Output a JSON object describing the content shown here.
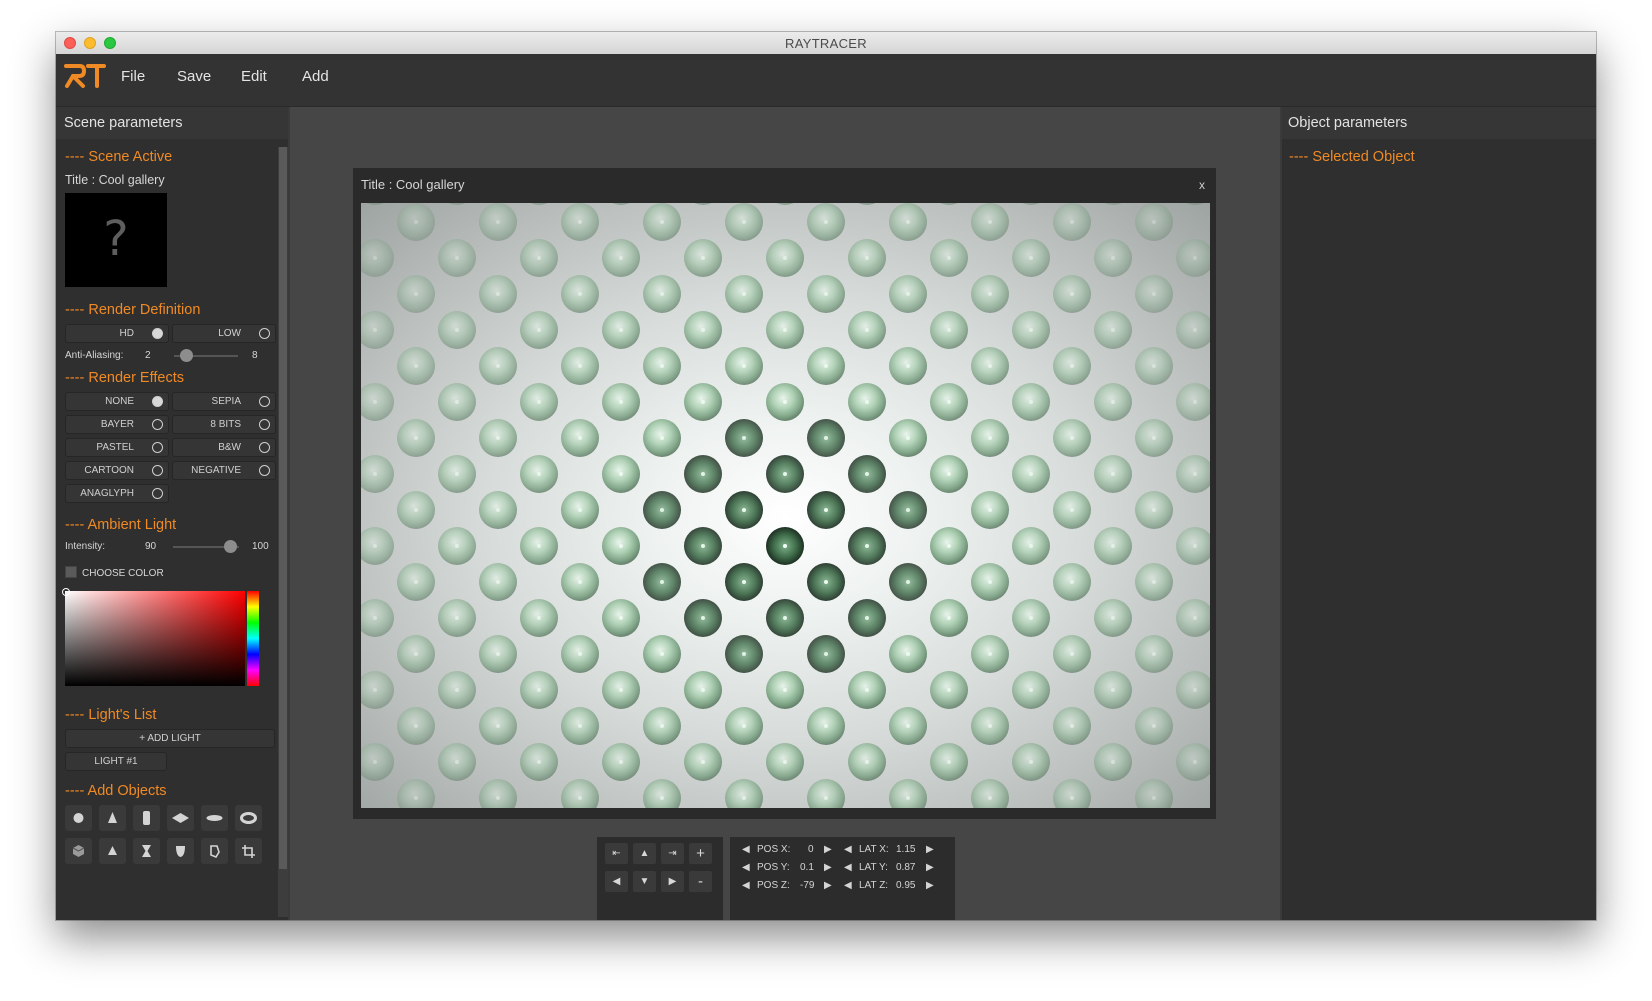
{
  "window": {
    "title": "RAYTRACER"
  },
  "menu": {
    "logo": "RT",
    "items": [
      "File",
      "Save",
      "Edit",
      "Add"
    ]
  },
  "left_panel": {
    "header": "Scene parameters",
    "scene_active": {
      "section": "---- Scene Active",
      "title": "Title : Cool gallery",
      "thumbnail_glyph": "?"
    },
    "render_definition": {
      "section": "---- Render Definition",
      "hd": "HD",
      "low": "LOW",
      "selected": "HD",
      "aa_label": "Anti-Aliasing:",
      "aa_value": "2",
      "aa_max": "8"
    },
    "render_effects": {
      "section": "---- Render Effects",
      "effects": [
        "NONE",
        "SEPIA",
        "BAYER",
        "8 BITS",
        "PASTEL",
        "B&W",
        "CARTOON",
        "NEGATIVE",
        "ANAGLYPH"
      ],
      "selected": "NONE"
    },
    "ambient_light": {
      "section": "---- Ambient Light",
      "intensity_label": "Intensity:",
      "intensity_value": "90",
      "intensity_max": "100",
      "choose_color": "CHOOSE COLOR",
      "color_hue": "#ff0000"
    },
    "lights_list": {
      "section": "---- Light's List",
      "add_light": "+ ADD LIGHT",
      "lights": [
        "LIGHT #1"
      ]
    },
    "add_objects": {
      "section": "---- Add Objects",
      "icons": [
        "sphere-icon",
        "cone-icon",
        "cylinder-icon",
        "plane-icon",
        "disk-icon",
        "torus-icon",
        "cube-icon",
        "pyramid-icon",
        "hourglass-icon",
        "paraboloid-icon",
        "composed-icon",
        "crop-icon"
      ]
    }
  },
  "render": {
    "title": "Title : Cool gallery",
    "close": "x"
  },
  "camera": {
    "nav": {
      "rotate_left": "⇤",
      "up": "▲",
      "rotate_right": "⇥",
      "zoom_in": "+",
      "left": "◀",
      "down": "▼",
      "right": "▶",
      "zoom_out": "-"
    },
    "pos_x_label": "POS X:",
    "pos_x": "0",
    "pos_y_label": "POS Y:",
    "pos_y": "0.1",
    "pos_z_label": "POS Z:",
    "pos_z": "-79",
    "lat_x_label": "LAT X:",
    "lat_x": "1.15",
    "lat_y_label": "LAT Y:",
    "lat_y": "0.87",
    "lat_z_label": "LAT Z:",
    "lat_z": "0.95"
  },
  "right_panel": {
    "header": "Object parameters",
    "section": "---- Selected Object"
  },
  "colors": {
    "accent": "#f08a24",
    "panel": "#2f2f2f",
    "background": "#3a3a3a"
  }
}
